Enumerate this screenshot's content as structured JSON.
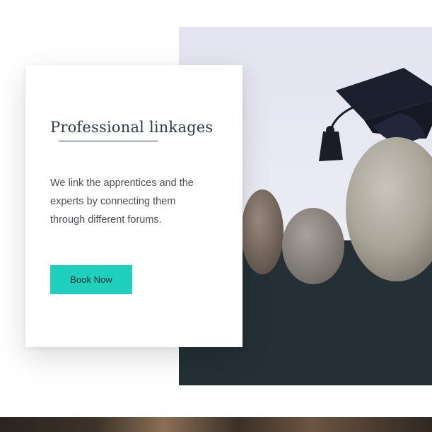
{
  "card": {
    "title": "Professional linkages",
    "description": "We link the apprentices and the experts by connecting them through different forums.",
    "button_label": "Book Now"
  },
  "colors": {
    "accent": "#1fd0bc",
    "heading": "#2f3b45",
    "body_text": "#4a4f55",
    "photo_top": "#e8e8f4",
    "photo_bottom": "#243036"
  },
  "icons": {
    "photo": "graduation-cap-and-stones-photo"
  }
}
